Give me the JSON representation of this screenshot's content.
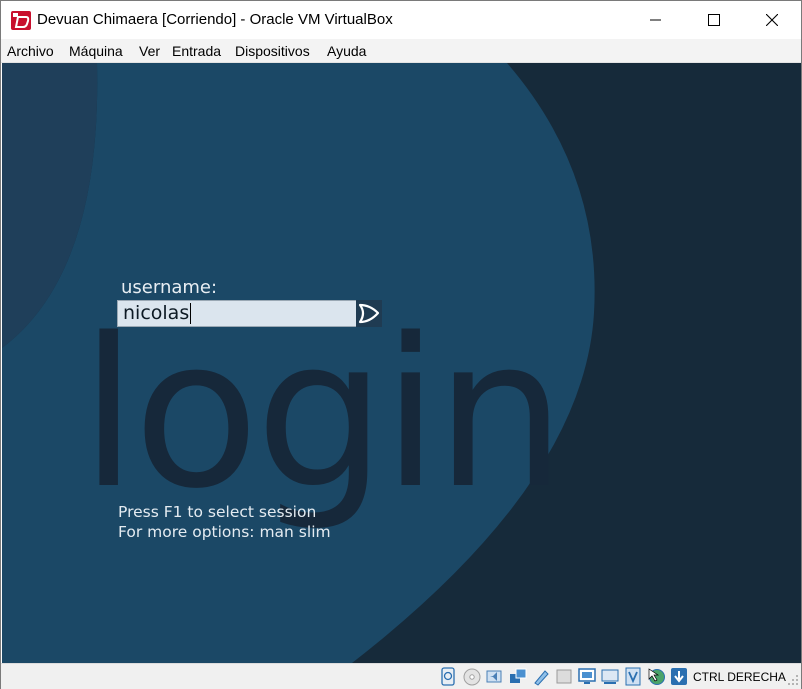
{
  "window": {
    "title": "Devuan Chimaera [Corriendo] - Oracle VM VirtualBox"
  },
  "menu": {
    "items": [
      "Archivo",
      "Máquina",
      "Ver",
      "Entrada",
      "Dispositivos",
      "Ayuda"
    ]
  },
  "vm": {
    "watermark": "login",
    "username_label": "username:",
    "username_value": "nicolas",
    "hints": [
      "Press F1 to select session",
      "For more options: man slim"
    ],
    "colors": {
      "background": "#162a3a",
      "swoosh": "#1b4866",
      "accent_left": "#1f3f5a"
    }
  },
  "statusbar": {
    "icons": [
      "hard-disk-icon",
      "optical-drive-icon",
      "audio-icon",
      "network-icon",
      "usb-icon",
      "shared-folders-icon",
      "display-icon",
      "video-capture-icon",
      "virtualization-icon",
      "mouse-integration-icon",
      "keyboard-capture-icon"
    ],
    "host_key": "CTRL DERECHA"
  }
}
